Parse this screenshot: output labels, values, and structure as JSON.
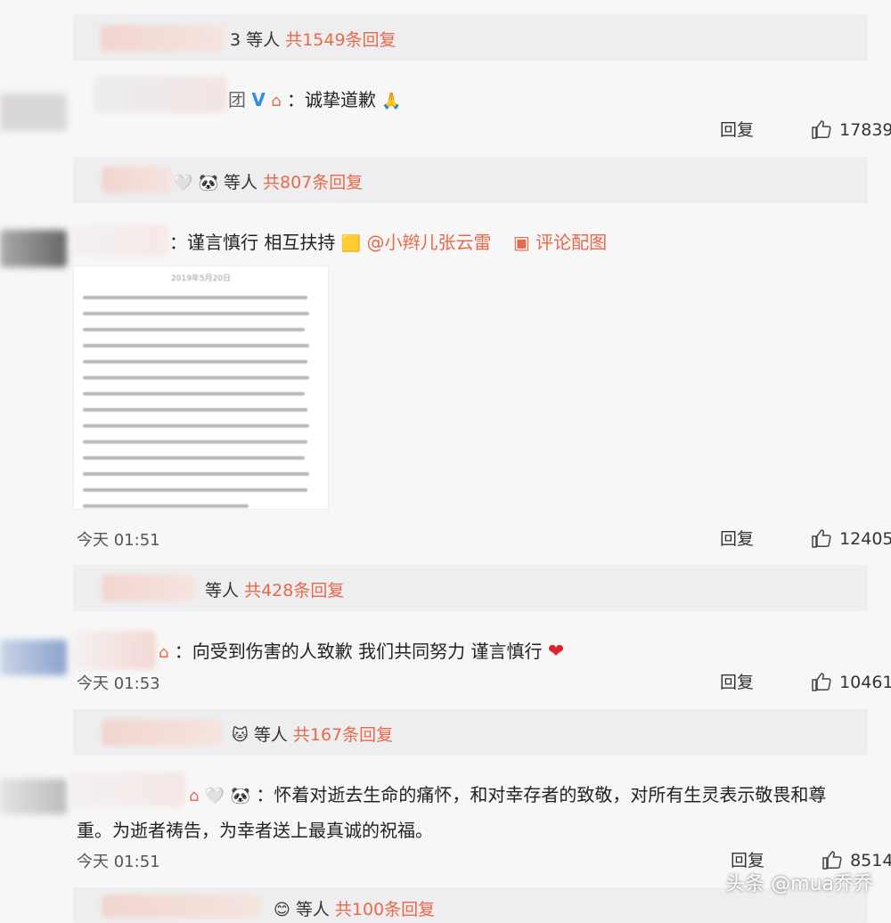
{
  "comments": [
    {
      "reply_bar": {
        "suffix": "3 等人",
        "count": "共1549条回复"
      },
      "name_suffix": "团",
      "text": "：诚挚道歉",
      "reply_label": "回复",
      "likes": "17839"
    },
    {
      "reply_bar": {
        "suffix": "等人",
        "count": "共807条回复"
      },
      "text": "：谨言慎行 相互扶持",
      "mention": "@小辫儿张云雷",
      "pic_link": "评论配图",
      "time": "今天 01:51",
      "reply_label": "回复",
      "likes": "12405"
    },
    {
      "reply_bar": {
        "suffix": "等人",
        "count": "共428条回复"
      },
      "text": "：向受到伤害的人致歉 我们共同努力 谨言慎行",
      "time": "今天 01:53",
      "reply_label": "回复",
      "likes": "10461"
    },
    {
      "reply_bar": {
        "suffix": "等人",
        "count": "共167条回复"
      },
      "text_line1": "：怀着对逝去生命的痛怀，和对幸存者的致敬，对所有生灵表示敬畏和尊",
      "text_line2": "重。为逝者祷告，为幸者送上最真诚的祝福。",
      "time": "今天 01:51",
      "reply_label": "回复",
      "likes": "8514"
    },
    {
      "reply_bar": {
        "suffix": "等人",
        "count": "共100条回复"
      }
    }
  ],
  "image_date": "2019年5月20日",
  "watermark": "头条 @mua乔乔",
  "colors": {
    "accent": "#e8684a",
    "background": "#f7f7f8",
    "reply_bar": "#eeeef0"
  }
}
